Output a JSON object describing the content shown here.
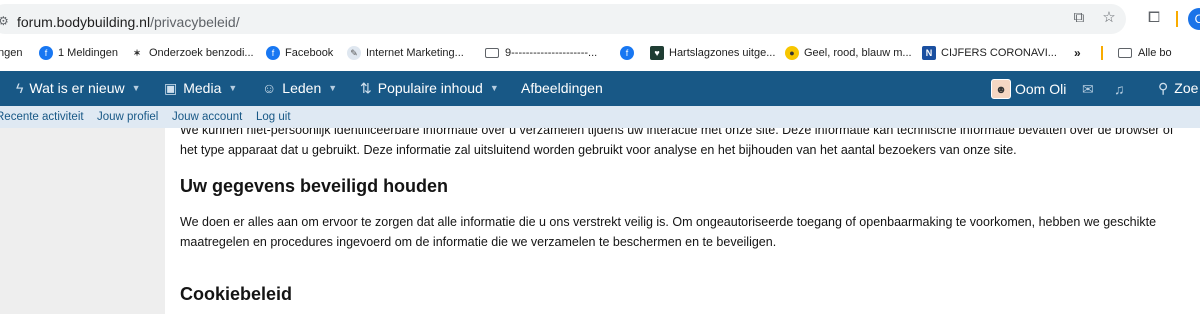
{
  "browser": {
    "url_host": "forum.bodybuilding.nl",
    "url_path": "/privacybeleid/",
    "profile_initial": "C",
    "icons": [
      "site-info-icon",
      "install-app-icon",
      "star-icon",
      "extensions-icon"
    ]
  },
  "bookmarks": {
    "items": [
      {
        "label": "ngen",
        "icon": "none"
      },
      {
        "label": "1 Meldingen",
        "icon": "facebook-icon"
      },
      {
        "label": "Onderzoek benzodi...",
        "icon": "site-icon"
      },
      {
        "label": "Facebook",
        "icon": "facebook-icon"
      },
      {
        "label": "Internet Marketing...",
        "icon": "site-icon"
      },
      {
        "label": "9---------------------...",
        "icon": "folder-icon"
      },
      {
        "label": "",
        "icon": "facebook-icon"
      },
      {
        "label": "Hartslagzones uitge...",
        "icon": "site-icon"
      },
      {
        "label": "Geel, rood, blauw m...",
        "icon": "site-icon"
      },
      {
        "label": "CIJFERS CORONAVI...",
        "icon": "site-icon"
      }
    ],
    "more": "»",
    "other_folder": "Alle bo"
  },
  "nav": {
    "items": [
      {
        "label": "Wat is er nieuw",
        "icon": "bolt-icon"
      },
      {
        "label": "Media",
        "icon": "camera-icon"
      },
      {
        "label": "Leden",
        "icon": "users-icon"
      },
      {
        "label": "Populaire inhoud",
        "icon": "sort-icon"
      },
      {
        "label": "Afbeeldingen",
        "icon": "none"
      }
    ],
    "user_name": "Oom Oli",
    "search_label": "Zoe"
  },
  "subnav": {
    "items": [
      "Recente activiteit",
      "Jouw profiel",
      "Jouw account",
      "Log uit"
    ]
  },
  "content": {
    "p1": "We kunnen niet-persoonlijk identificeerbare informatie over u verzamelen tijdens uw interactie met onze site. Deze informatie kan technische informatie bevatten over de browser of het type apparaat dat u gebruikt. Deze informatie zal uitsluitend worden gebruikt voor analyse en het bijhouden van het aantal bezoekers van onze site.",
    "h2": "Uw gegevens beveiligd houden",
    "p2": "We doen er alles aan om ervoor te zorgen dat alle informatie die u ons verstrekt veilig is. Om ongeautoriseerde toegang of openbaarmaking te voorkomen, hebben we geschikte maatregelen en procedures ingevoerd om de informatie die we verzamelen te beschermen en te beveiligen.",
    "h3": "Cookiebeleid"
  },
  "colors": {
    "nav_bg": "#185886",
    "subnav_bg": "#dfe9f3",
    "sidebar_bg": "#eeeeee"
  }
}
